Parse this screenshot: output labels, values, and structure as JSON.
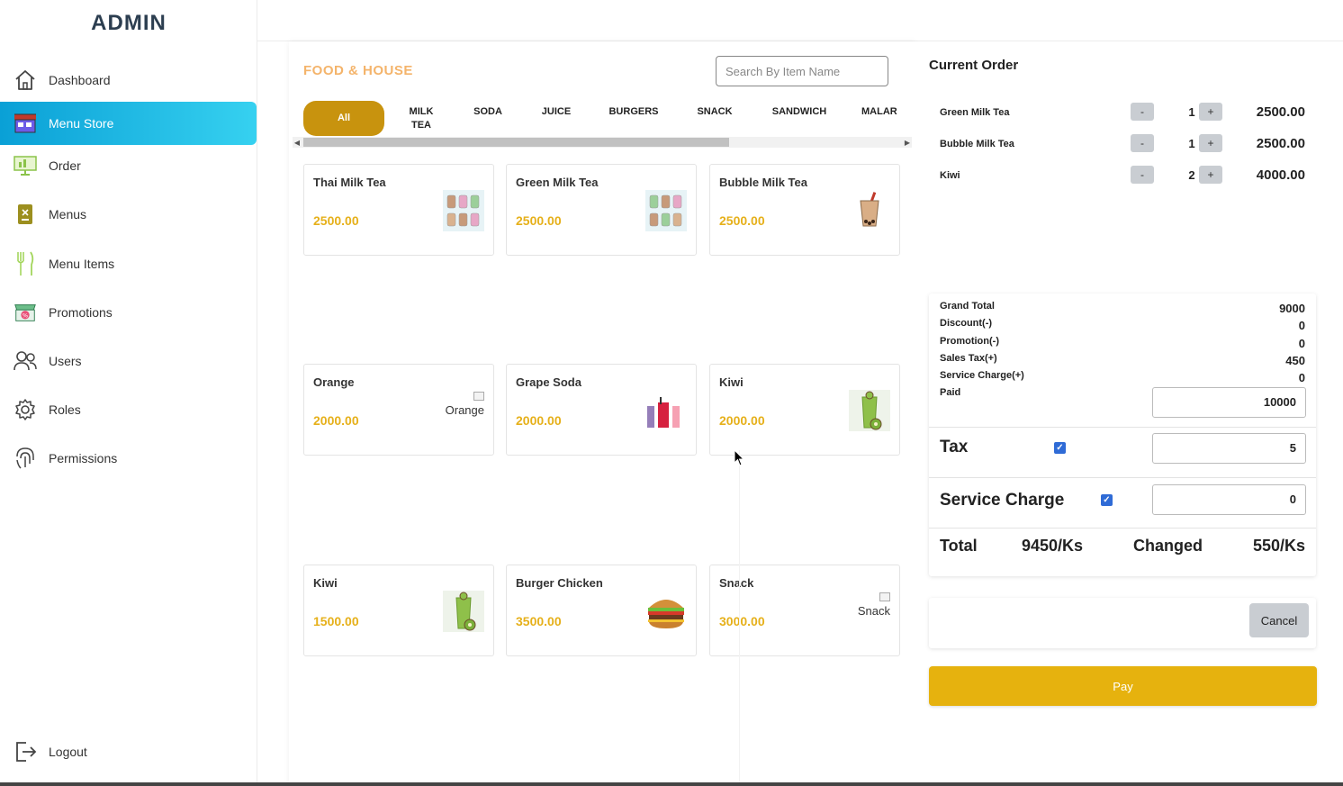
{
  "app": {
    "brand": "ADMIN"
  },
  "sidebar": {
    "items": [
      {
        "label": "Dashboard",
        "icon": "home-icon"
      },
      {
        "label": "Menu Store",
        "icon": "store-icon",
        "active": true
      },
      {
        "label": "Order",
        "icon": "monitor-icon"
      },
      {
        "label": "Menus",
        "icon": "menu-book-icon"
      },
      {
        "label": "Menu Items",
        "icon": "fork-knife-icon"
      },
      {
        "label": "Promotions",
        "icon": "shop-promo-icon"
      },
      {
        "label": "Users",
        "icon": "users-icon"
      },
      {
        "label": "Roles",
        "icon": "gear-icon"
      },
      {
        "label": "Permissions",
        "icon": "fingerprint-icon"
      }
    ],
    "logout": {
      "label": "Logout",
      "icon": "logout-icon"
    }
  },
  "store": {
    "title": "FOOD & HOUSE",
    "search_placeholder": "Search By Item Name",
    "tabs": [
      "All",
      "MILK TEA",
      "SODA",
      "JUICE",
      "BURGERS",
      "SNACK",
      "SANDWICH",
      "MALAR"
    ],
    "items": [
      {
        "name": "Thai Milk Tea",
        "price": "2500.00",
        "image": "milk-tea-cups"
      },
      {
        "name": "Green Milk Tea",
        "price": "2500.00",
        "image": "milk-tea-cups"
      },
      {
        "name": "Bubble Milk Tea",
        "price": "2500.00",
        "image": "bubble-tea-cup"
      },
      {
        "name": "Orange",
        "price": "2000.00",
        "image_alt": "Orange"
      },
      {
        "name": "Grape Soda",
        "price": "2000.00",
        "image": "soda-glasses"
      },
      {
        "name": "Kiwi",
        "price": "2000.00",
        "image": "kiwi-juice"
      },
      {
        "name": "Kiwi",
        "price": "1500.00",
        "image": "kiwi-juice"
      },
      {
        "name": "Burger Chicken",
        "price": "3500.00",
        "image": "burger"
      },
      {
        "name": "Snack",
        "price": "3000.00",
        "image_alt": "Snack"
      }
    ]
  },
  "order": {
    "title": "Current Order",
    "minus": "-",
    "plus": "+",
    "lines": [
      {
        "name": "Green Milk Tea",
        "qty": "1",
        "price": "2500.00"
      },
      {
        "name": "Bubble Milk Tea",
        "qty": "1",
        "price": "2500.00"
      },
      {
        "name": "Kiwi",
        "qty": "2",
        "price": "4000.00"
      }
    ],
    "summary": {
      "grand_total_label": "Grand Total",
      "grand_total": "9000",
      "discount_label": "Discount(-)",
      "discount": "0",
      "promotion_label": "Promotion(-)",
      "promotion": "0",
      "sales_tax_label": "Sales Tax(+)",
      "sales_tax": "450",
      "service_charge_label": "Service Charge(+)",
      "service_charge": "0",
      "paid_label": "Paid",
      "paid": "10000",
      "tax_label": "Tax",
      "tax_value": "5",
      "svc_label": "Service Charge",
      "svc_value": "0",
      "total_label": "Total",
      "total_value": "9450/Ks",
      "changed_label": "Changed",
      "changed_value": "550/Ks"
    },
    "cancel_label": "Cancel",
    "pay_label": "Pay"
  },
  "colors": {
    "accent": "#c8930e",
    "price": "#e6b01a",
    "pay": "#e6b20e",
    "active_nav": "#0aa0d6"
  }
}
